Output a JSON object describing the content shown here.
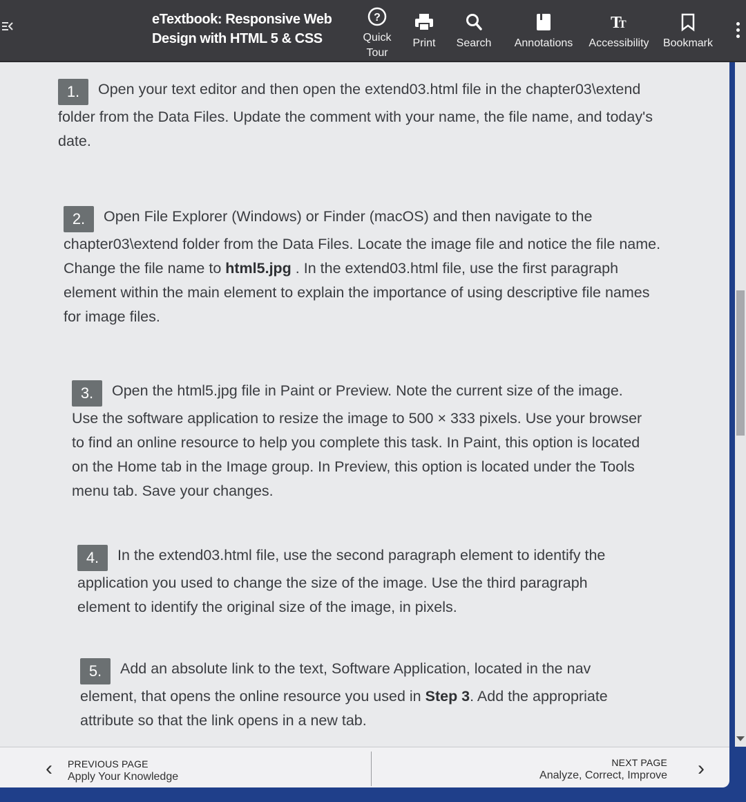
{
  "toolbar": {
    "title": "eTextbook: Responsive Web Design with HTML 5 & CSS",
    "quick_tour": "Quick Tour",
    "print": "Print",
    "search": "Search",
    "annotations": "Annotations",
    "accessibility": "Accessibility",
    "bookmark": "Bookmark"
  },
  "steps": [
    {
      "number": "1.",
      "text": "Open your text editor and then open the extend03.html file in the chapter03\\extend folder from the Data Files. Update the comment with your name, the file name, and today's date."
    },
    {
      "number": "2.",
      "text_a": "Open File Explorer (Windows) or Finder (macOS) and then navigate to the chapter03\\extend folder from the Data Files. Locate the image file and notice the file name. Change the file name to ",
      "bold": "html5.jpg",
      "text_b": " . In the extend03.html file, use the first paragraph element within the main element to explain the importance of using descriptive file names for image files."
    },
    {
      "number": "3.",
      "text": "Open the html5.jpg file in Paint or Preview. Note the current size of the image. Use the software application to resize the image to 500 × 333 pixels. Use your browser to find an online resource to help you complete this task. In Paint, this option is located on the Home tab in the Image group. In Preview, this option is located under the Tools menu tab. Save your changes."
    },
    {
      "number": "4.",
      "text": "In the extend03.html file, use the second paragraph element to identify the application you used to change the size of the image. Use the third paragraph element to identify the original size of the image, in pixels."
    },
    {
      "number": "5.",
      "text_a": "Add an absolute link to the text, Software Application, located in the nav element, that opens the online resource you used in ",
      "bold": "Step 3",
      "text_b": ". Add the appropriate attribute so that the link opens in a new tab."
    }
  ],
  "footer": {
    "prev_label": "PREVIOUS PAGE",
    "prev_title": "Apply Your Knowledge",
    "next_label": "NEXT PAGE",
    "next_title": "Analyze, Correct, Improve"
  },
  "colors": {
    "toolbar_bg": "#3b3b3f",
    "content_bg": "#e9eaec",
    "step_badge": "#6b7072",
    "frame": "#1f3f8a"
  }
}
